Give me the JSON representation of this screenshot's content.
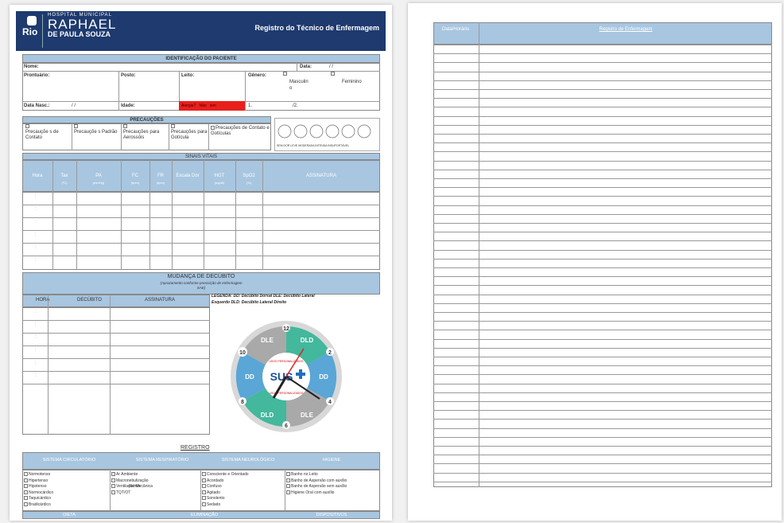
{
  "header": {
    "hospital_line": "HOSPITAL MUNICIPAL",
    "name_line1": "RAPHAEL",
    "name_line2": "DE PAULA SOUZA",
    "logo_text": "Rio",
    "title": "Registro do Técnico de Enfermagem"
  },
  "id_section": {
    "title": "IDENTIFICAÇÃO DO PACIENTE",
    "nome": "Nome:",
    "data": "Data:",
    "data_slashes": "/     /",
    "prontuario": "Prontuário:",
    "posto": "Posto:",
    "leito": "Leito:",
    "genero": "Gênero:",
    "masculino": "Masculin",
    "masc_o": "o",
    "feminino": "Feminino",
    "data_nasc": "Data Nasc.:",
    "nasc_slashes": "/     /",
    "idade": "Idade:",
    "alergia": "Alergia?",
    "alergia_nao": "Não",
    "alergia_sim": "sim",
    "allergy_1": "1.",
    "allergy_2": "/2."
  },
  "precaucoes": {
    "title": "PRECAUÇÕES",
    "items": [
      "Precauçõe s de Contato",
      "Precauçõe s Padrão",
      "Precauções para Aerossóis",
      "Precauções para Gotícula",
      "Precauções de Contato e Gotículas"
    ],
    "pain_scale_labels": "SEM DOR   LEVE   MODERADA   INTENSA   INSUPORTÁVEL"
  },
  "sinais": {
    "title": "SINAIS VITAIS",
    "cols": [
      "Hora",
      "Tax",
      "PA",
      "FC",
      "FR",
      "Escala Dor",
      "HGT",
      "SpO2",
      "ASSINATURA"
    ],
    "subs": [
      "",
      "(ºC)",
      "(mmHg)",
      "(bpm)",
      "(irpm)",
      "",
      "(mg/dl)",
      "(%)",
      ""
    ],
    "hour_mark": ":"
  },
  "decubito": {
    "title": "MUDANÇA DE DECÚBITO",
    "subtitle": "(Aprazamento conforme prescrição de enfermagem",
    "subtitle2": "SAE)",
    "cols": [
      "HORA",
      "DECÚBITO",
      "ASSINATURA"
    ],
    "hour_mark": ":",
    "legend1": "LEGENDA: DD: Decúbito Dorsal DLE: Decúbito Lateral",
    "legend2": "Esquerdo DLD: Decúbito Lateral Direito"
  },
  "clock": {
    "labels": {
      "dle": "DLE",
      "dld": "DLD",
      "dd": "DD",
      "n12": "12",
      "n2": "2",
      "n4": "4",
      "n6": "6",
      "n8": "8",
      "n10": "10",
      "center": "SUS",
      "top_note": "USOS PERSONALIZADOS",
      "bottom_note": "USOS PERSONALIZADOS"
    }
  },
  "registro": {
    "title": "REGISTRO",
    "cols": [
      "SISTEMA CIRCULATÓRIO",
      "SISTEMA RESPIRATÓRIO",
      "SISTEMA NEUROLÓGICO",
      "HIGIENE"
    ],
    "circ": [
      "Normotenso",
      "Hipertenso",
      "Hipotenso",
      "Normocárdico",
      "Taquicárdico",
      "Bradicárdico"
    ],
    "resp": [
      "Ar Ambiente",
      "Macronebulização",
      "Ventilação Mecânica",
      "TQT/OT"
    ],
    "resp_extra": "lts/min",
    "neuro": [
      "Consciente e Orientado",
      "Acordado",
      "Confuso",
      "Agitado",
      "Sonolento",
      "Sedado"
    ],
    "hig": [
      "Banho no Leito",
      "Banho de Aspersão com auxílio",
      "Banho de Aspersão sem auxílio",
      "Higiene Oral com auxílio"
    ],
    "footer": [
      "DIETA",
      "ELIMINAÇÃO",
      "DISPOSITIVOS"
    ]
  },
  "page2": {
    "col1": "Data/Horário",
    "col2": "Registro de Enfermagem"
  }
}
